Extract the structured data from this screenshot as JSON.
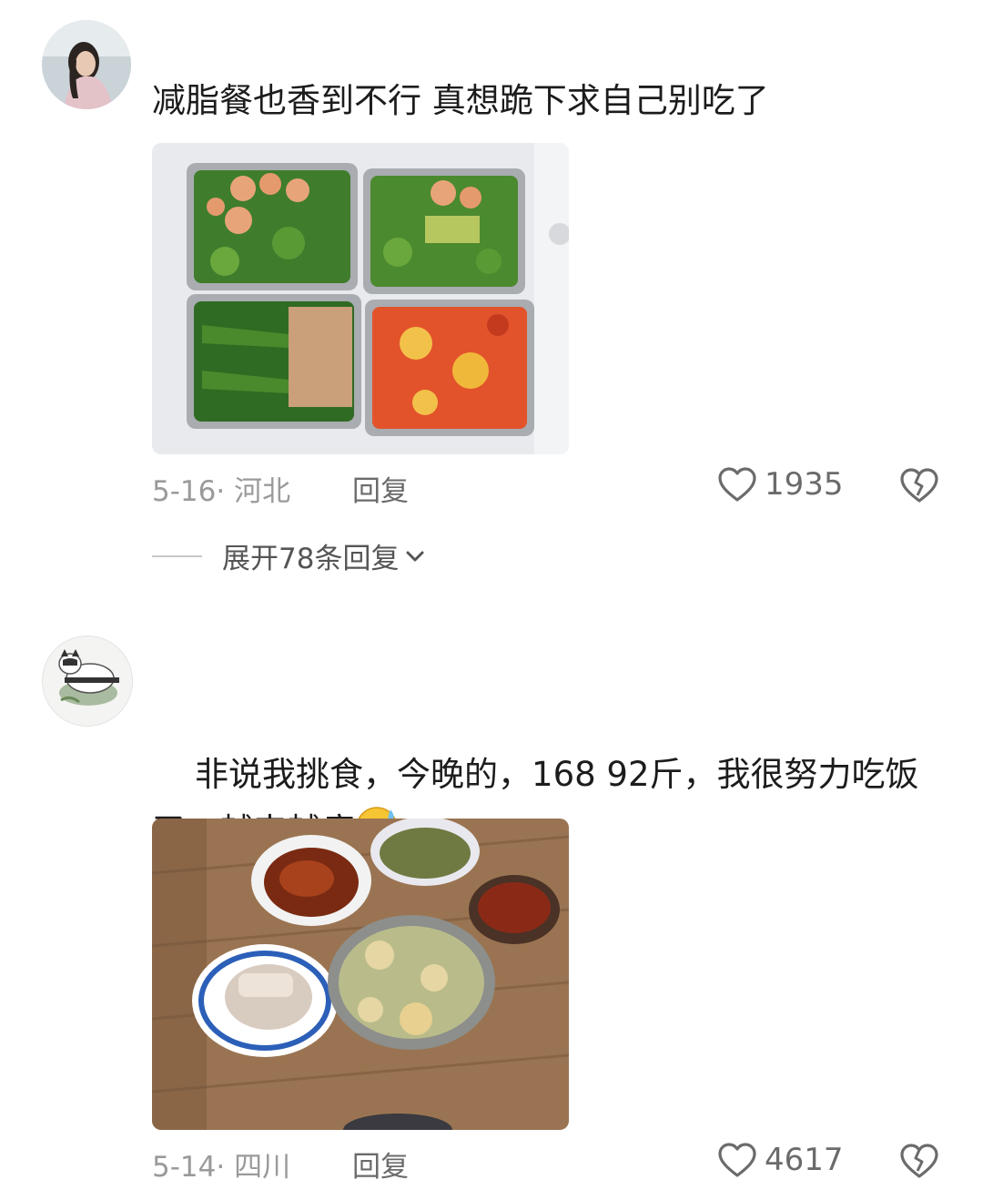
{
  "comments": [
    {
      "text": "减脂餐也香到不行 真想跪下求自己别吃了",
      "date": "5-16",
      "location": "河北",
      "reply_label": "回复",
      "likes": "1935",
      "expand_label": "展开78条回复",
      "photo": "meal-prep-containers"
    },
    {
      "text": "非说我挑食，今晚的，168 92斤，我很努力吃饭\n了，越来越瘦",
      "emoji": "grin-sweat-emoji",
      "date": "5-14",
      "location": "四川",
      "reply_label": "回复",
      "likes": "4617",
      "photo": "dinner-table-bowls"
    }
  ],
  "colors": {
    "text": "#1c1c1c",
    "meta": "#9a9a9a",
    "icon": "#6b6b6b"
  },
  "icons": [
    "heart-icon",
    "broken-heart-icon",
    "chevron-down-icon"
  ]
}
